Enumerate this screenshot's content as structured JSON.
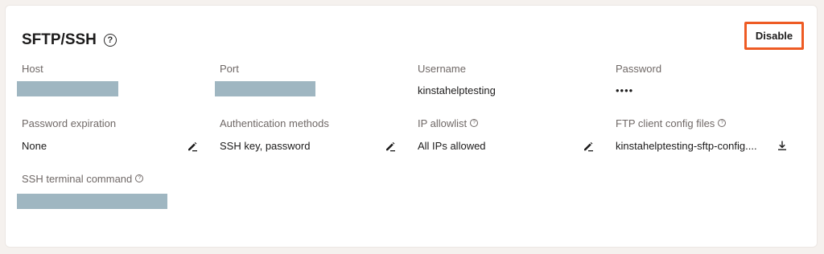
{
  "section": {
    "title": "SFTP/SSH",
    "disable_label": "Disable"
  },
  "fields": {
    "host": {
      "label": "Host"
    },
    "port": {
      "label": "Port"
    },
    "username": {
      "label": "Username",
      "value": "kinstahelptesting"
    },
    "password": {
      "label": "Password",
      "value": "••••"
    },
    "password_expiration": {
      "label": "Password expiration",
      "value": "None"
    },
    "auth_methods": {
      "label": "Authentication methods",
      "value": "SSH key, password"
    },
    "ip_allowlist": {
      "label": "IP allowlist",
      "value": "All IPs allowed"
    },
    "ftp_config": {
      "label": "FTP client config files",
      "value": "kinstahelptesting-sftp-config...."
    },
    "ssh_command": {
      "label": "SSH terminal command"
    }
  },
  "colors": {
    "accent": "#ee5b24",
    "redaction": "#9fb6c1",
    "label": "#6f6866"
  },
  "icons": {
    "help": "question-circle-icon",
    "edit": "pencil-icon",
    "download": "download-icon"
  }
}
